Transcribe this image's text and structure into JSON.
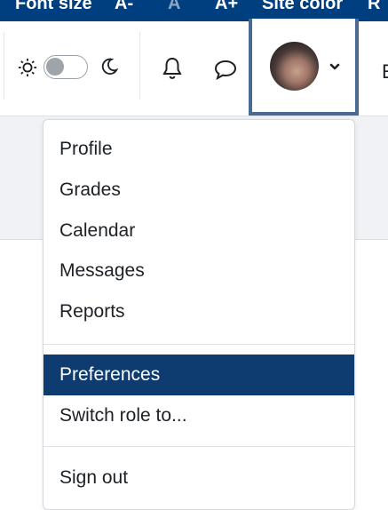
{
  "accessibility_bar": {
    "font_size_label": "Font size",
    "decrease_label": "A-",
    "reset_label": "A",
    "increase_label": "A+",
    "site_color_label": "Site color",
    "cut_label": "R"
  },
  "navbar": {
    "theme_toggle": {
      "state": "light"
    },
    "icons": [
      "sun-icon",
      "moon-icon",
      "bell-icon",
      "chat-icon",
      "chevron-down-icon"
    ],
    "cut_text": "E"
  },
  "user_menu": {
    "items": [
      {
        "label": "Profile"
      },
      {
        "label": "Grades"
      },
      {
        "label": "Calendar"
      },
      {
        "label": "Messages"
      },
      {
        "label": "Reports"
      },
      {
        "label": "Preferences",
        "active": true
      },
      {
        "label": "Switch role to..."
      },
      {
        "label": "Sign out"
      }
    ]
  },
  "colors": {
    "brand_blue": "#003f7f",
    "active_item_bg": "#0f3c70",
    "focus_border": "#4a6a93",
    "text": "#1d2125"
  }
}
